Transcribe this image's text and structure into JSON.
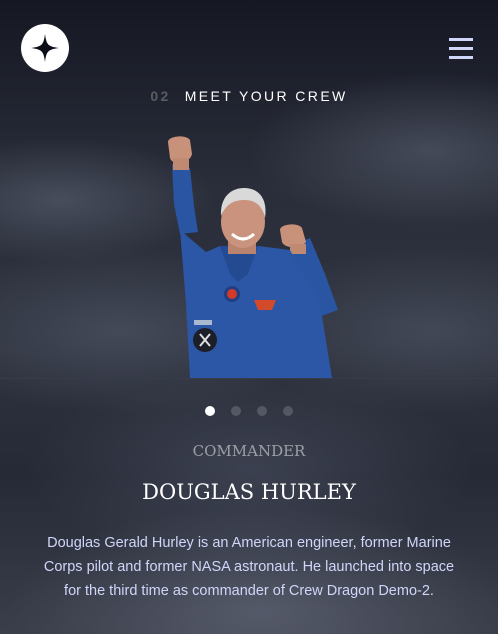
{
  "header": {
    "logo_icon": "star-logo-icon",
    "menu_icon": "hamburger-menu-icon"
  },
  "page": {
    "number": "02",
    "title": "MEET YOUR CREW"
  },
  "crew": {
    "role": "COMMANDER",
    "name": "DOUGLAS HURLEY",
    "bio": "Douglas Gerald Hurley is an American engineer, former Marine Corps pilot and former NASA astronaut. He launched into space for the third time as commander of Crew Dragon Demo-2.",
    "photo_description_icon": "astronaut-portrait-image"
  },
  "pagination": {
    "total": 4,
    "active": 1
  },
  "colors": {
    "background": "#0b0d17",
    "text_light": "#d0d6f9",
    "white": "#ffffff"
  }
}
